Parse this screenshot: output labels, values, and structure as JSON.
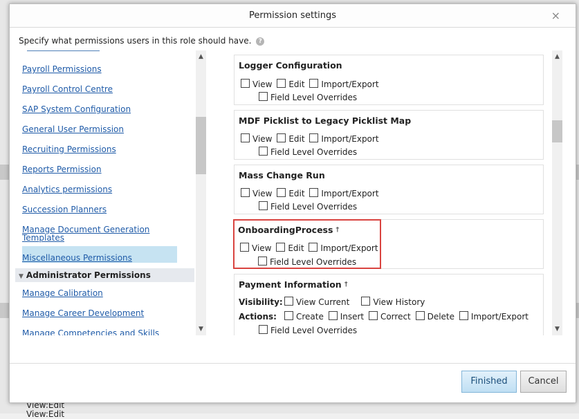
{
  "dialog": {
    "title": "Permission settings",
    "close_glyph": "×",
    "intro": "Specify what permissions users in this role should have.",
    "help_glyph": "?"
  },
  "left_nav": {
    "items": [
      "Payroll Permissions",
      "Payroll Control Centre",
      "SAP System Configuration",
      "General User Permission",
      "Recruiting Permissions",
      "Reports Permission",
      "Analytics permissions",
      "Succession Planners",
      "Manage Document Generation Templates",
      "Miscellaneous Permissions"
    ],
    "selected": "Miscellaneous Permissions",
    "section_header": "Administrator Permissions",
    "section_items": [
      "Manage Calibration",
      "Manage Career Development",
      "Manage Competencies and Skills"
    ]
  },
  "permissions": [
    {
      "title": "Logger Configuration",
      "options": [
        "View",
        "Edit",
        "Import/Export"
      ],
      "override": "Field Level Overrides"
    },
    {
      "title": "MDF Picklist to Legacy Picklist Map",
      "options": [
        "View",
        "Edit",
        "Import/Export"
      ],
      "override": "Field Level Overrides"
    },
    {
      "title": "Mass Change Run",
      "options": [
        "View",
        "Edit",
        "Import/Export"
      ],
      "override": "Field Level Overrides"
    },
    {
      "title": "OnboardingProcess",
      "dagger": "†",
      "highlighted": true,
      "options": [
        "View",
        "Edit",
        "Import/Export"
      ],
      "override": "Field Level Overrides"
    },
    {
      "title": "Payment Information",
      "dagger": "†",
      "visibility_label": "Visibility:",
      "visibility": [
        "View Current",
        "View History"
      ],
      "actions_label": "Actions:",
      "actions": [
        "Create",
        "Insert",
        "Correct",
        "Delete",
        "Import/Export"
      ],
      "override": "Field Level Overrides"
    }
  ],
  "buttons": {
    "finished": "Finished",
    "cancel": "Cancel"
  },
  "background": {
    "text1": "View:Edit",
    "text2": "View:Edit"
  },
  "colors": {
    "link": "#1f5ba8",
    "highlight_border": "#d9433f",
    "selected_bg": "#c6e3f2"
  }
}
